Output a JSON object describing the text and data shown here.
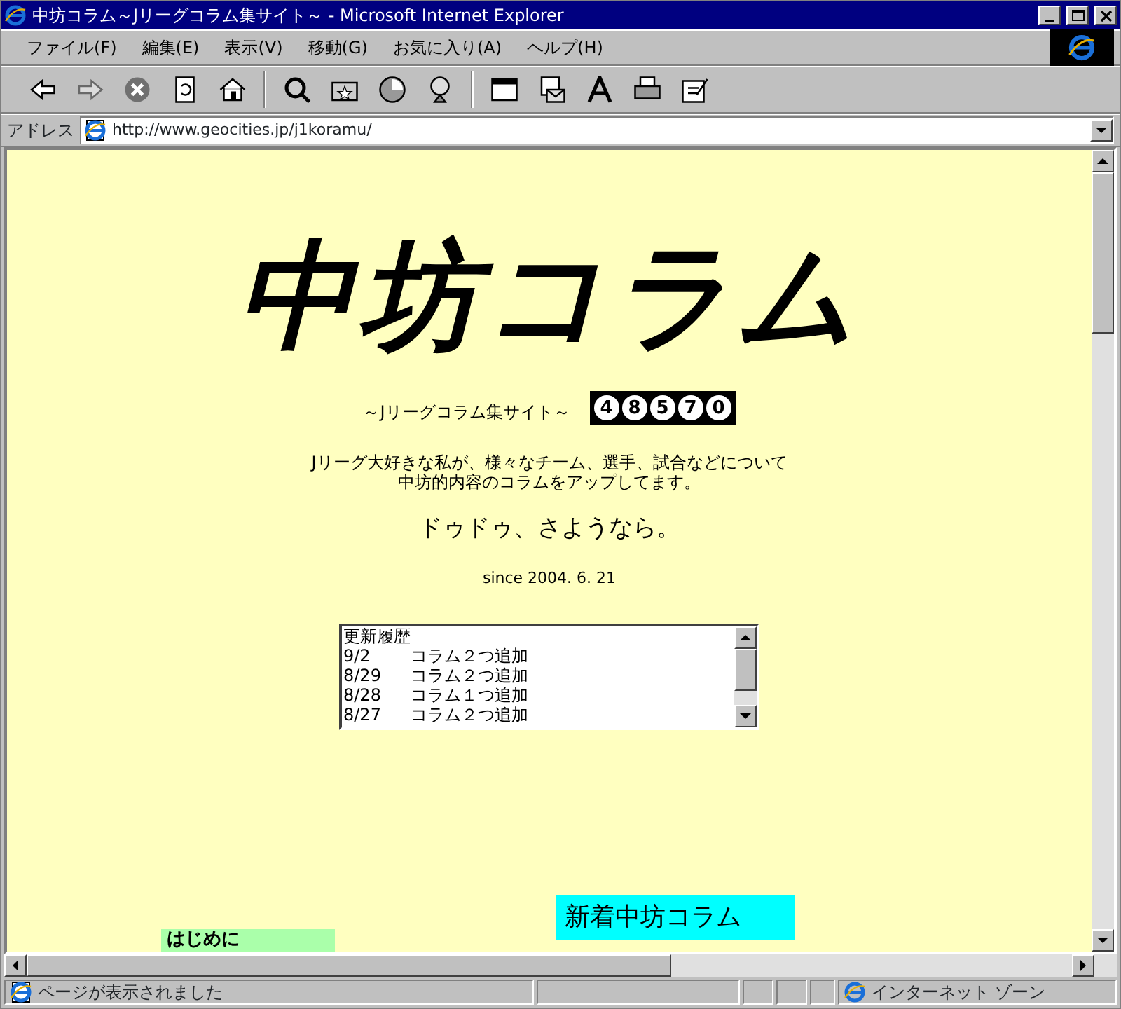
{
  "window": {
    "title": "中坊コラム～Jリーグコラム集サイト～ - Microsoft Internet Explorer"
  },
  "menu": [
    "ファイル(F)",
    "編集(E)",
    "表示(V)",
    "移動(G)",
    "お気に入り(A)",
    "ヘルプ(H)"
  ],
  "toolbar": [
    {
      "kind": "back",
      "disabled": false
    },
    {
      "kind": "forward",
      "disabled": true
    },
    {
      "kind": "stop",
      "disabled": false
    },
    {
      "kind": "refresh",
      "disabled": false
    },
    {
      "kind": "home",
      "disabled": false
    },
    {
      "kind": "sep"
    },
    {
      "kind": "search",
      "disabled": false
    },
    {
      "kind": "favorites",
      "disabled": false
    },
    {
      "kind": "history",
      "disabled": false
    },
    {
      "kind": "channels",
      "disabled": false
    },
    {
      "kind": "sep"
    },
    {
      "kind": "fullscreen",
      "disabled": false
    },
    {
      "kind": "mail",
      "disabled": false
    },
    {
      "kind": "font",
      "disabled": false
    },
    {
      "kind": "print",
      "disabled": false
    },
    {
      "kind": "edit",
      "disabled": false
    }
  ],
  "address": {
    "label": "アドレス",
    "url": "http://www.geocities.jp/j1koramu/"
  },
  "page": {
    "logo": "中坊コラム",
    "subtitle": "～Jリーグコラム集サイト～",
    "counter": [
      "4",
      "8",
      "5",
      "7",
      "0"
    ],
    "intro": [
      "Jリーグ大好きな私が、様々なチーム、選手、試合などについて",
      "中坊的内容のコラムをアップしてます。"
    ],
    "headline": "ドゥドゥ、さようなら。",
    "since": "since 2004. 6. 21",
    "history": {
      "title": "更新履歴",
      "rows": [
        {
          "date": "9/2",
          "text": "コラム２つ追加"
        },
        {
          "date": "8/29",
          "text": "コラム２つ追加"
        },
        {
          "date": "8/28",
          "text": "コラム１つ追加"
        },
        {
          "date": "8/27",
          "text": "コラム２つ追加"
        }
      ]
    },
    "intro_heading": "はじめに",
    "new_heading": "新着中坊コラム"
  },
  "status_bar": {
    "message": "ページが表示されました",
    "zone": "インターネット ゾーン"
  }
}
